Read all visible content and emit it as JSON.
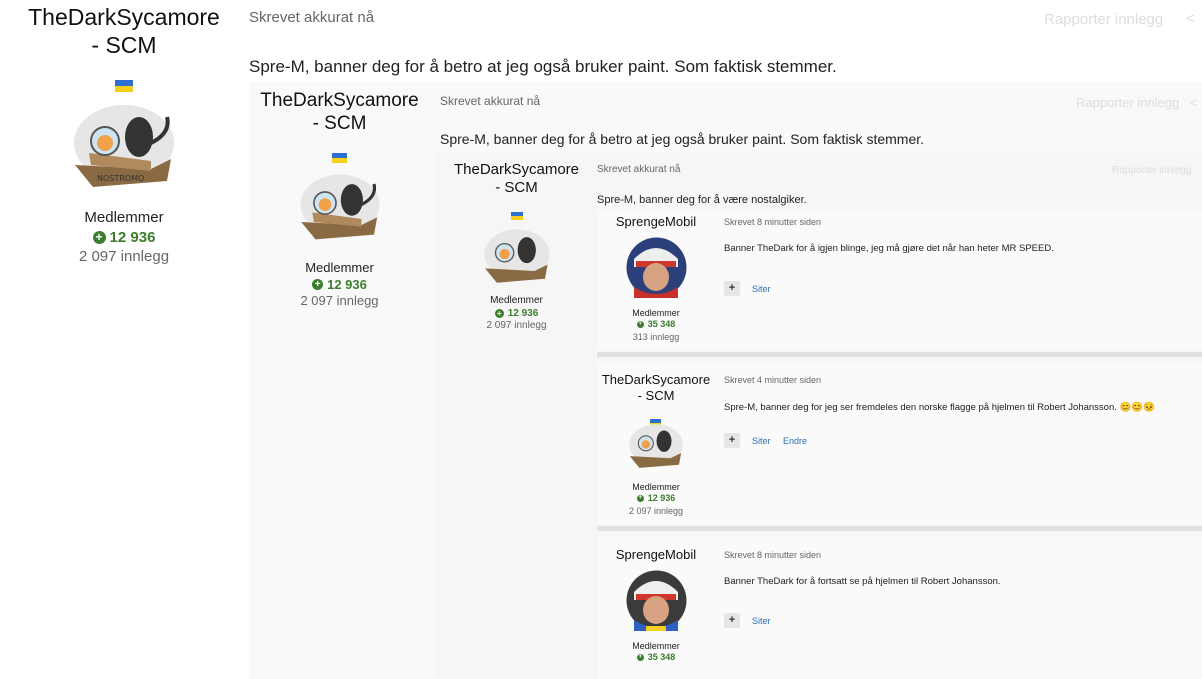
{
  "post": {
    "author": "TheDarkSycamore - SCM",
    "author_line1": "TheDarkSycamore",
    "author_line2": "- SCM",
    "group": "Medlemmer",
    "reputation": "12 936",
    "posts": "2 097 innlegg",
    "time": "Skrevet akkurat nå",
    "text": "Spre-M, banner deg for å betro at jeg også bruker paint. Som faktisk stemmer.",
    "report": "Rapporter innlegg"
  },
  "nested1": {
    "author_line1": "TheDarkSycamore",
    "author_line2": "- SCM",
    "group": "Medlemmer",
    "reputation": "12 936",
    "posts": "2 097 innlegg",
    "time": "Skrevet akkurat nå",
    "text": "Spre-M, banner deg for å betro at jeg også bruker paint. Som faktisk stemmer.",
    "report": "Rapporter innlegg"
  },
  "nested2": {
    "author_line1": "TheDarkSycamore",
    "author_line2": "- SCM",
    "group": "Medlemmer",
    "reputation": "12 936",
    "posts": "2 097 innlegg",
    "time": "Skrevet akkurat nå",
    "text": "Spre-M, banner deg for å være nostalgiker.",
    "report": "Rapporter innlegg"
  },
  "thread": [
    {
      "author": "SprengeMobil",
      "time": "Skrevet 8 minutter siden",
      "text": "Banner TheDark for å igjen blinge, jeg må gjøre det når han heter MR SPEED.",
      "group": "Medlemmer",
      "reputation": "35 348",
      "posts": "313 innlegg",
      "quote": "Siter"
    },
    {
      "author_line1": "TheDarkSycamore",
      "author_line2": "- SCM",
      "time": "Skrevet 4 minutter siden",
      "text": "Spre-M, banner deg for jeg ser fremdeles den norske flagge på hjelmen til Robert Johansson. 😊😊😣",
      "group": "Medlemmer",
      "reputation": "12 936",
      "posts": "2 097 innlegg",
      "quote": "Siter",
      "edit": "Endre"
    },
    {
      "author": "SprengeMobil",
      "time": "Skrevet 8 minutter siden",
      "text": "Banner TheDark for å fortsatt se på hjelmen til Robert Johansson.",
      "group": "Medlemmer",
      "reputation": "35 348",
      "quote": "Siter"
    }
  ],
  "colors": {
    "reputation": "#3c7d2e",
    "link": "#2a6fb5",
    "flag_blue": "#2f6ed1",
    "flag_yellow": "#f4cf1b"
  },
  "icons": [
    "ukraine-flag-icon",
    "plus-circle-icon",
    "share-icon",
    "quote-plus-icon"
  ]
}
